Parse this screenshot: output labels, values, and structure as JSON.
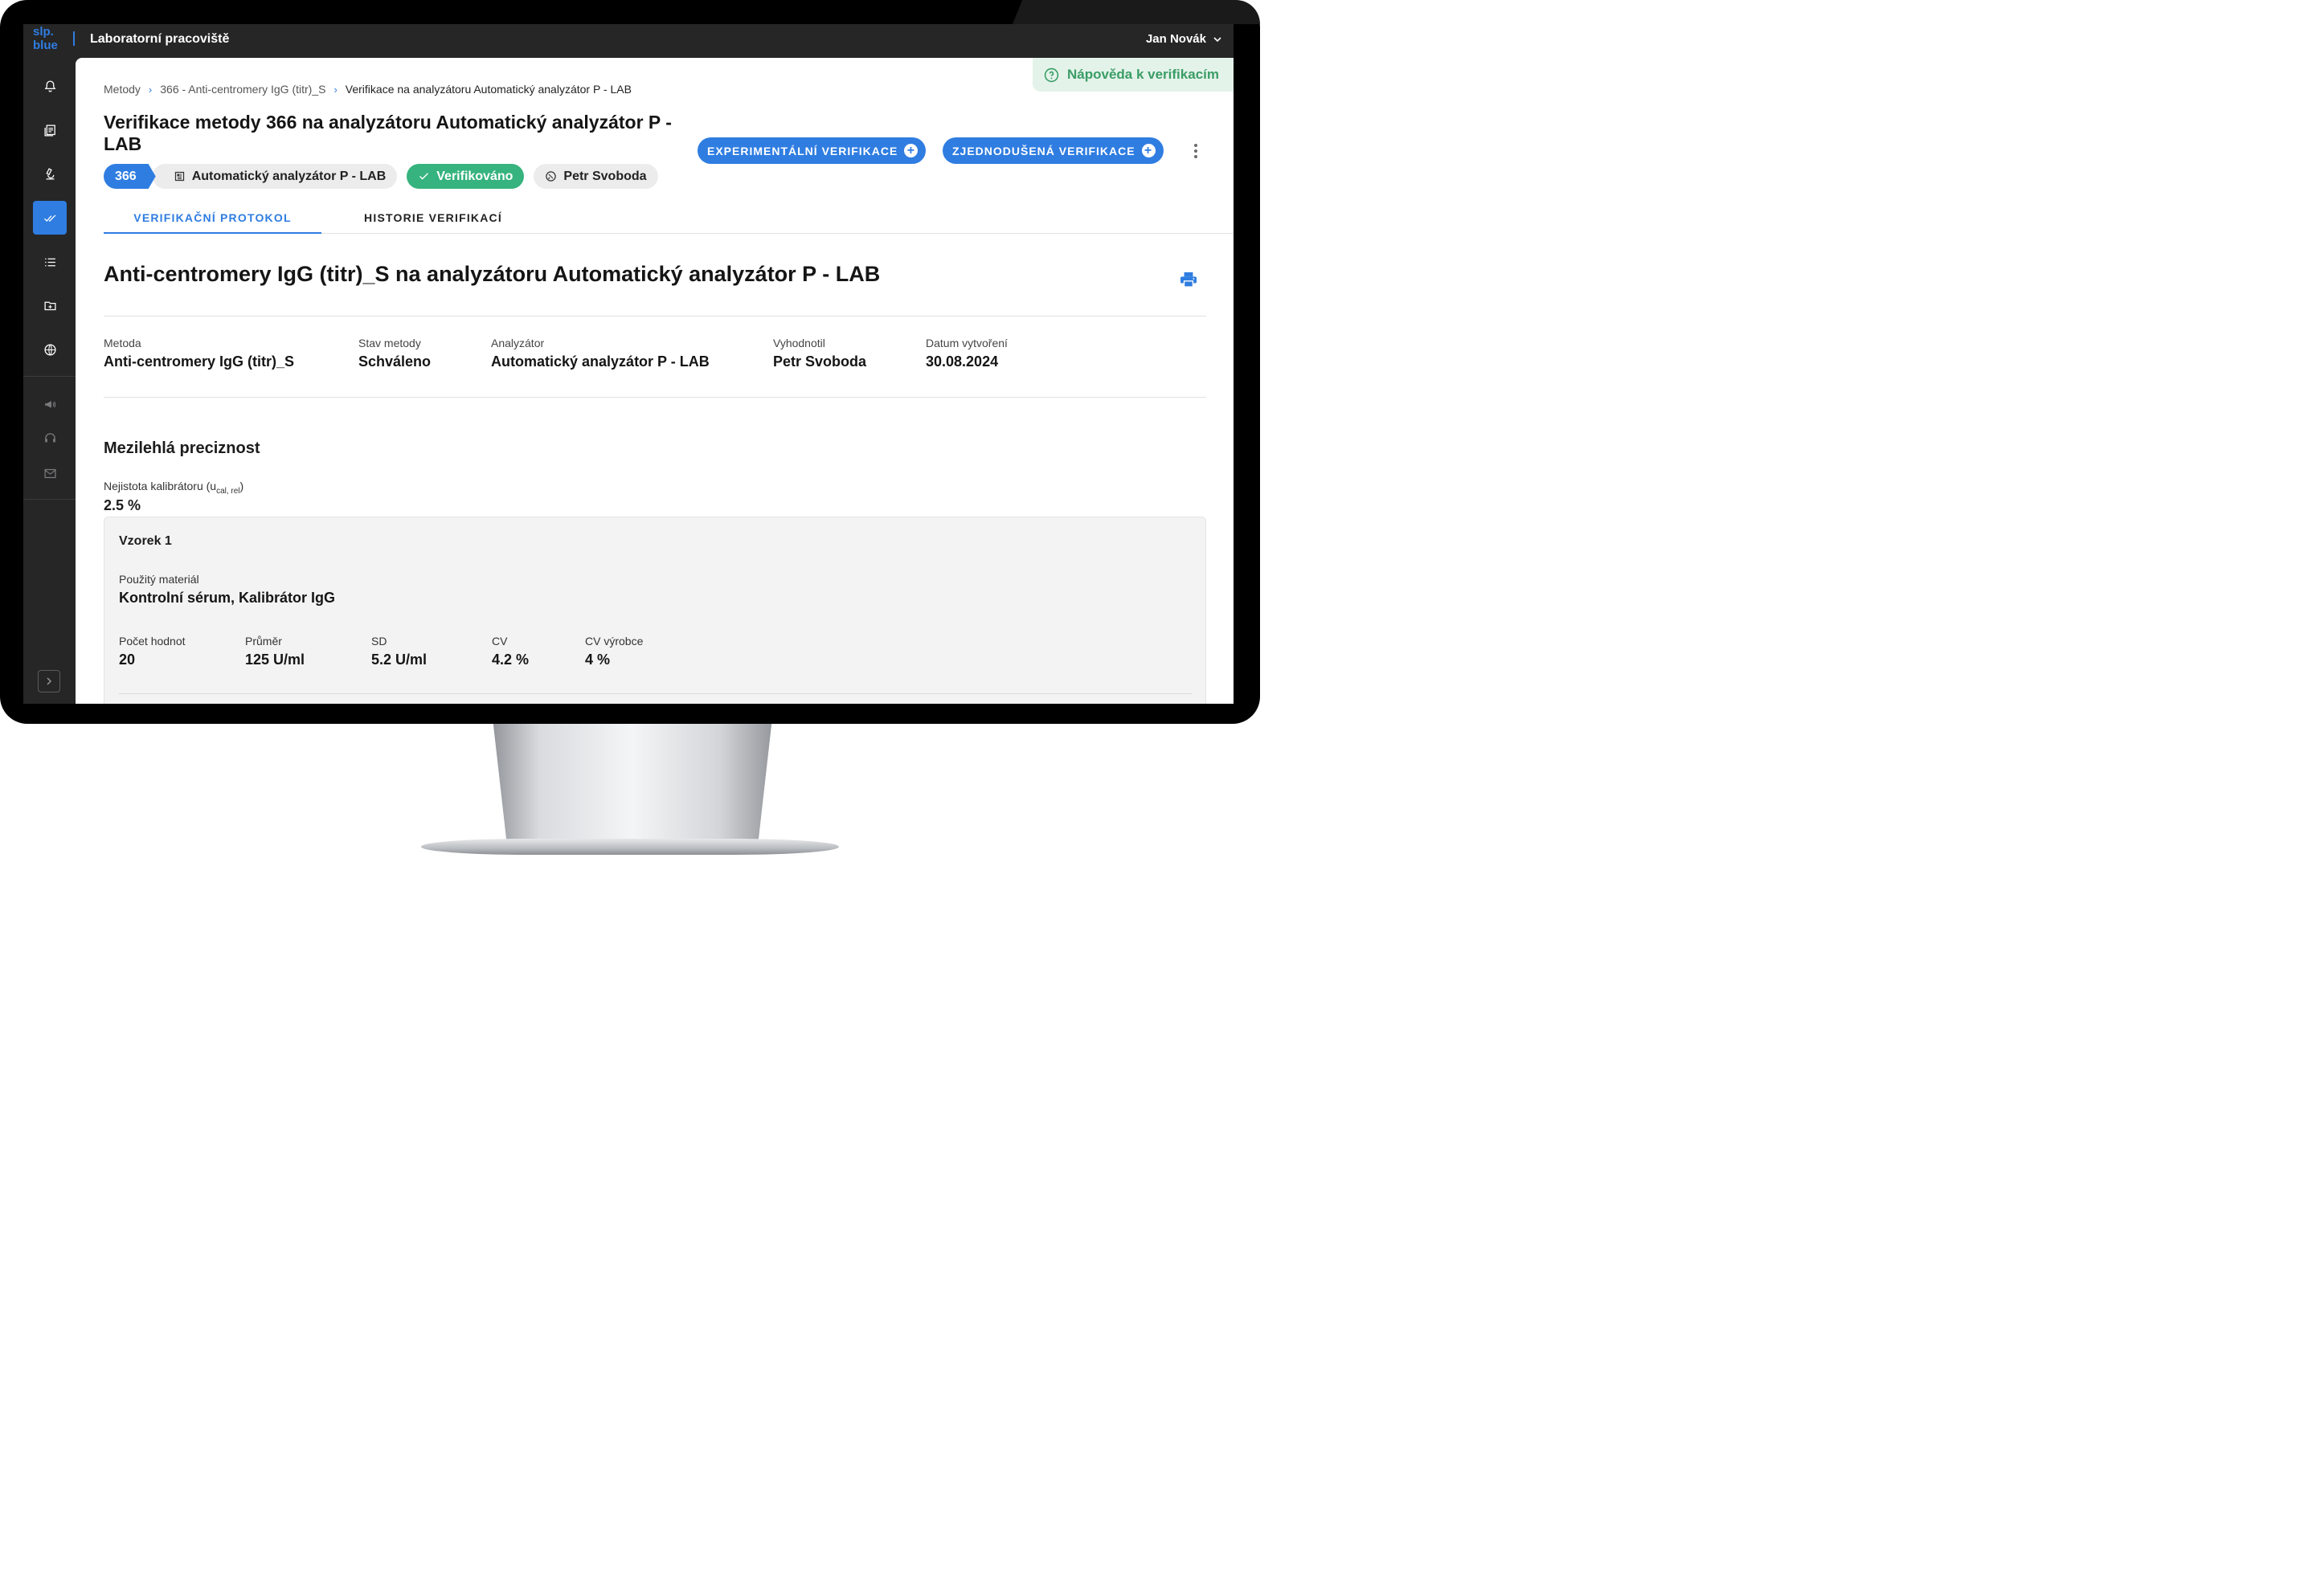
{
  "app": {
    "logo_line1": "slp.",
    "logo_line2": "blue",
    "title": "Laboratorní pracoviště",
    "user": "Jan Novák"
  },
  "sidebar": {
    "items": [
      {
        "name": "notifications",
        "icon": "bell-icon"
      },
      {
        "name": "documents",
        "icon": "documents-icon"
      },
      {
        "name": "laboratory",
        "icon": "microscope-icon"
      },
      {
        "name": "verifications",
        "icon": "double-check-icon",
        "active": true
      },
      {
        "name": "list",
        "icon": "list-icon"
      },
      {
        "name": "folder",
        "icon": "folder-add-icon"
      },
      {
        "name": "global",
        "icon": "globe-icon"
      },
      {
        "name": "announcements",
        "icon": "megaphone-icon"
      },
      {
        "name": "support",
        "icon": "headset-icon"
      },
      {
        "name": "messages",
        "icon": "mail-icon"
      }
    ]
  },
  "help": {
    "label": "Nápověda k verifikacím"
  },
  "breadcrumb": {
    "items": [
      "Metody",
      "366 - Anti-centromery IgG (titr)_S"
    ],
    "current": "Verifikace na analyzátoru Automatický analyzátor P - LAB"
  },
  "header": {
    "title": "Verifikace metody 366 na analyzátoru Automatický analyzátor P - LAB",
    "method_id": "366",
    "analyzer": "Automatický analyzátor P - LAB",
    "status": "Verifikováno",
    "person": "Petr Svoboda",
    "btn_experimental": "EXPERIMENTÁLNÍ VERIFIKACE",
    "btn_simplified": "ZJEDNODUŠENÁ VERIFIKACE"
  },
  "tabs": {
    "protocol": "VERIFIKAČNÍ PROTOKOL",
    "history": "HISTORIE VERIFIKACÍ"
  },
  "protocol": {
    "title": "Anti-centromery IgG (titr)_S na analyzátoru Automatický analyzátor P - LAB",
    "meta": {
      "method_label": "Metoda",
      "method_value": "Anti-centromery IgG (titr)_S",
      "state_label": "Stav metody",
      "state_value": "Schváleno",
      "analyzer_label": "Analyzátor",
      "analyzer_value": "Automatický analyzátor P - LAB",
      "evaluated_label": "Vyhodnotil",
      "evaluated_value": "Petr Svoboda",
      "created_label": "Datum vytvoření",
      "created_value": "30.08.2024"
    },
    "precision": {
      "title": "Mezilehlá preciznost",
      "uncertainty_label": "Nejistota kalibrátoru (u",
      "uncertainty_sub": "cal, rel",
      "uncertainty_close": ")",
      "uncertainty_value": "2.5 %"
    },
    "sample": {
      "title": "Vzorek 1",
      "material_label": "Použitý materiál",
      "material_value": "Kontrolní sérum, Kalibrátor IgG",
      "count_label": "Počet hodnot",
      "count_value": "20",
      "mean_label": "Průměr",
      "mean_value": "125 U/ml",
      "sd_label": "SD",
      "sd_value": "5.2 U/ml",
      "cv_label": "CV",
      "cv_value": "4.2 %",
      "cv_man_label": "CV výrobce",
      "cv_man_value": "4 %"
    }
  },
  "colors": {
    "accent": "#2f7de1",
    "success": "#36b37e",
    "help_bg": "#e4f3ea",
    "dark": "#262627"
  }
}
